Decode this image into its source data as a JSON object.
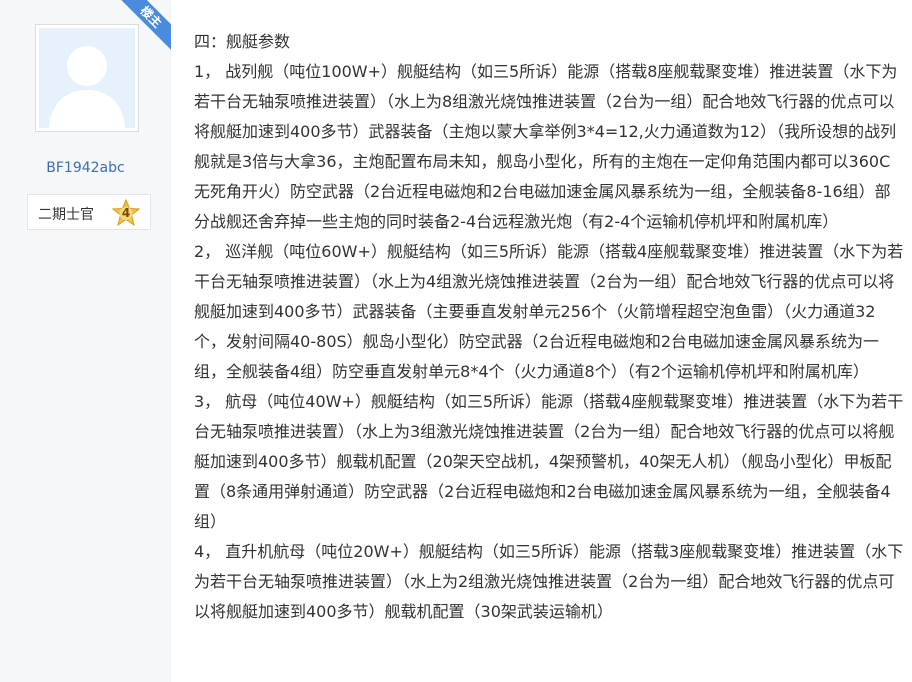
{
  "author": {
    "badge": "楼主",
    "username": "BF1942abc",
    "rank_title": "二期士官",
    "rank_level": "4"
  },
  "post": {
    "paragraphs": [
      "四：舰艇参数",
      "1，  战列舰（吨位100W+）舰艇结构（如三5所诉）能源（搭载8座舰载聚变堆）推进装置（水下为若干台无轴泵喷推进装置）（水上为8组激光烧蚀推进装置（2台为一组）配合地效飞行器的优点可以将舰艇加速到400多节）武器装备（主炮以蒙大拿举例3*4=12,火力通道数为12）（我所设想的战列舰就是3倍与大拿36，主炮配置布局未知，舰岛小型化，所有的主炮在一定仰角范围内都可以360C无死角开火）防空武器（2台近程电磁炮和2台电磁加速金属风暴系统为一组，全舰装备8-16组）部分战舰还舍弃掉一些主炮的同时装备2-4台远程激光炮（有2-4个运输机停机坪和附属机库）",
      "2，  巡洋舰（吨位60W+）舰艇结构（如三5所诉）能源（搭载4座舰载聚变堆）推进装置（水下为若干台无轴泵喷推进装置）（水上为4组激光烧蚀推进装置（2台为一组）配合地效飞行器的优点可以将舰艇加速到400多节）武器装备（主要垂直发射单元256个（火箭增程超空泡鱼雷）（火力通道32个，发射间隔40-80S）舰岛小型化）防空武器（2台近程电磁炮和2台电磁加速金属风暴系统为一组，全舰装备4组）防空垂直发射单元8*4个（火力通道8个）（有2个运输机停机坪和附属机库）",
      "3，  航母（吨位40W+）舰艇结构（如三5所诉）能源（搭载4座舰载聚变堆）推进装置（水下为若干台无轴泵喷推进装置）（水上为3组激光烧蚀推进装置（2台为一组）配合地效飞行器的优点可以将舰艇加速到400多节）舰载机配置（20架天空战机，4架预警机，40架无人机）（舰岛小型化）甲板配置（8条通用弹射通道）防空武器（2台近程电磁炮和2台电磁加速金属风暴系统为一组，全舰装备4组）",
      "4，  直升机航母（吨位20W+）舰艇结构（如三5所诉）能源（搭载3座舰载聚变堆）推进装置（水下为若干台无轴泵喷推进装置）（水上为2组激光烧蚀推进装置（2台为一组）配合地效飞行器的优点可以将舰艇加速到400多节）舰载机配置（30架武装运输机）"
    ]
  },
  "colors": {
    "ribbon": "#4a8bdd",
    "username": "#3a6fb5",
    "text": "#333333",
    "sidebar_bg": "#f6f7f9"
  },
  "icons": {
    "avatar": "default-avatar-silhouette",
    "rank_badge": "star-level-badge"
  }
}
